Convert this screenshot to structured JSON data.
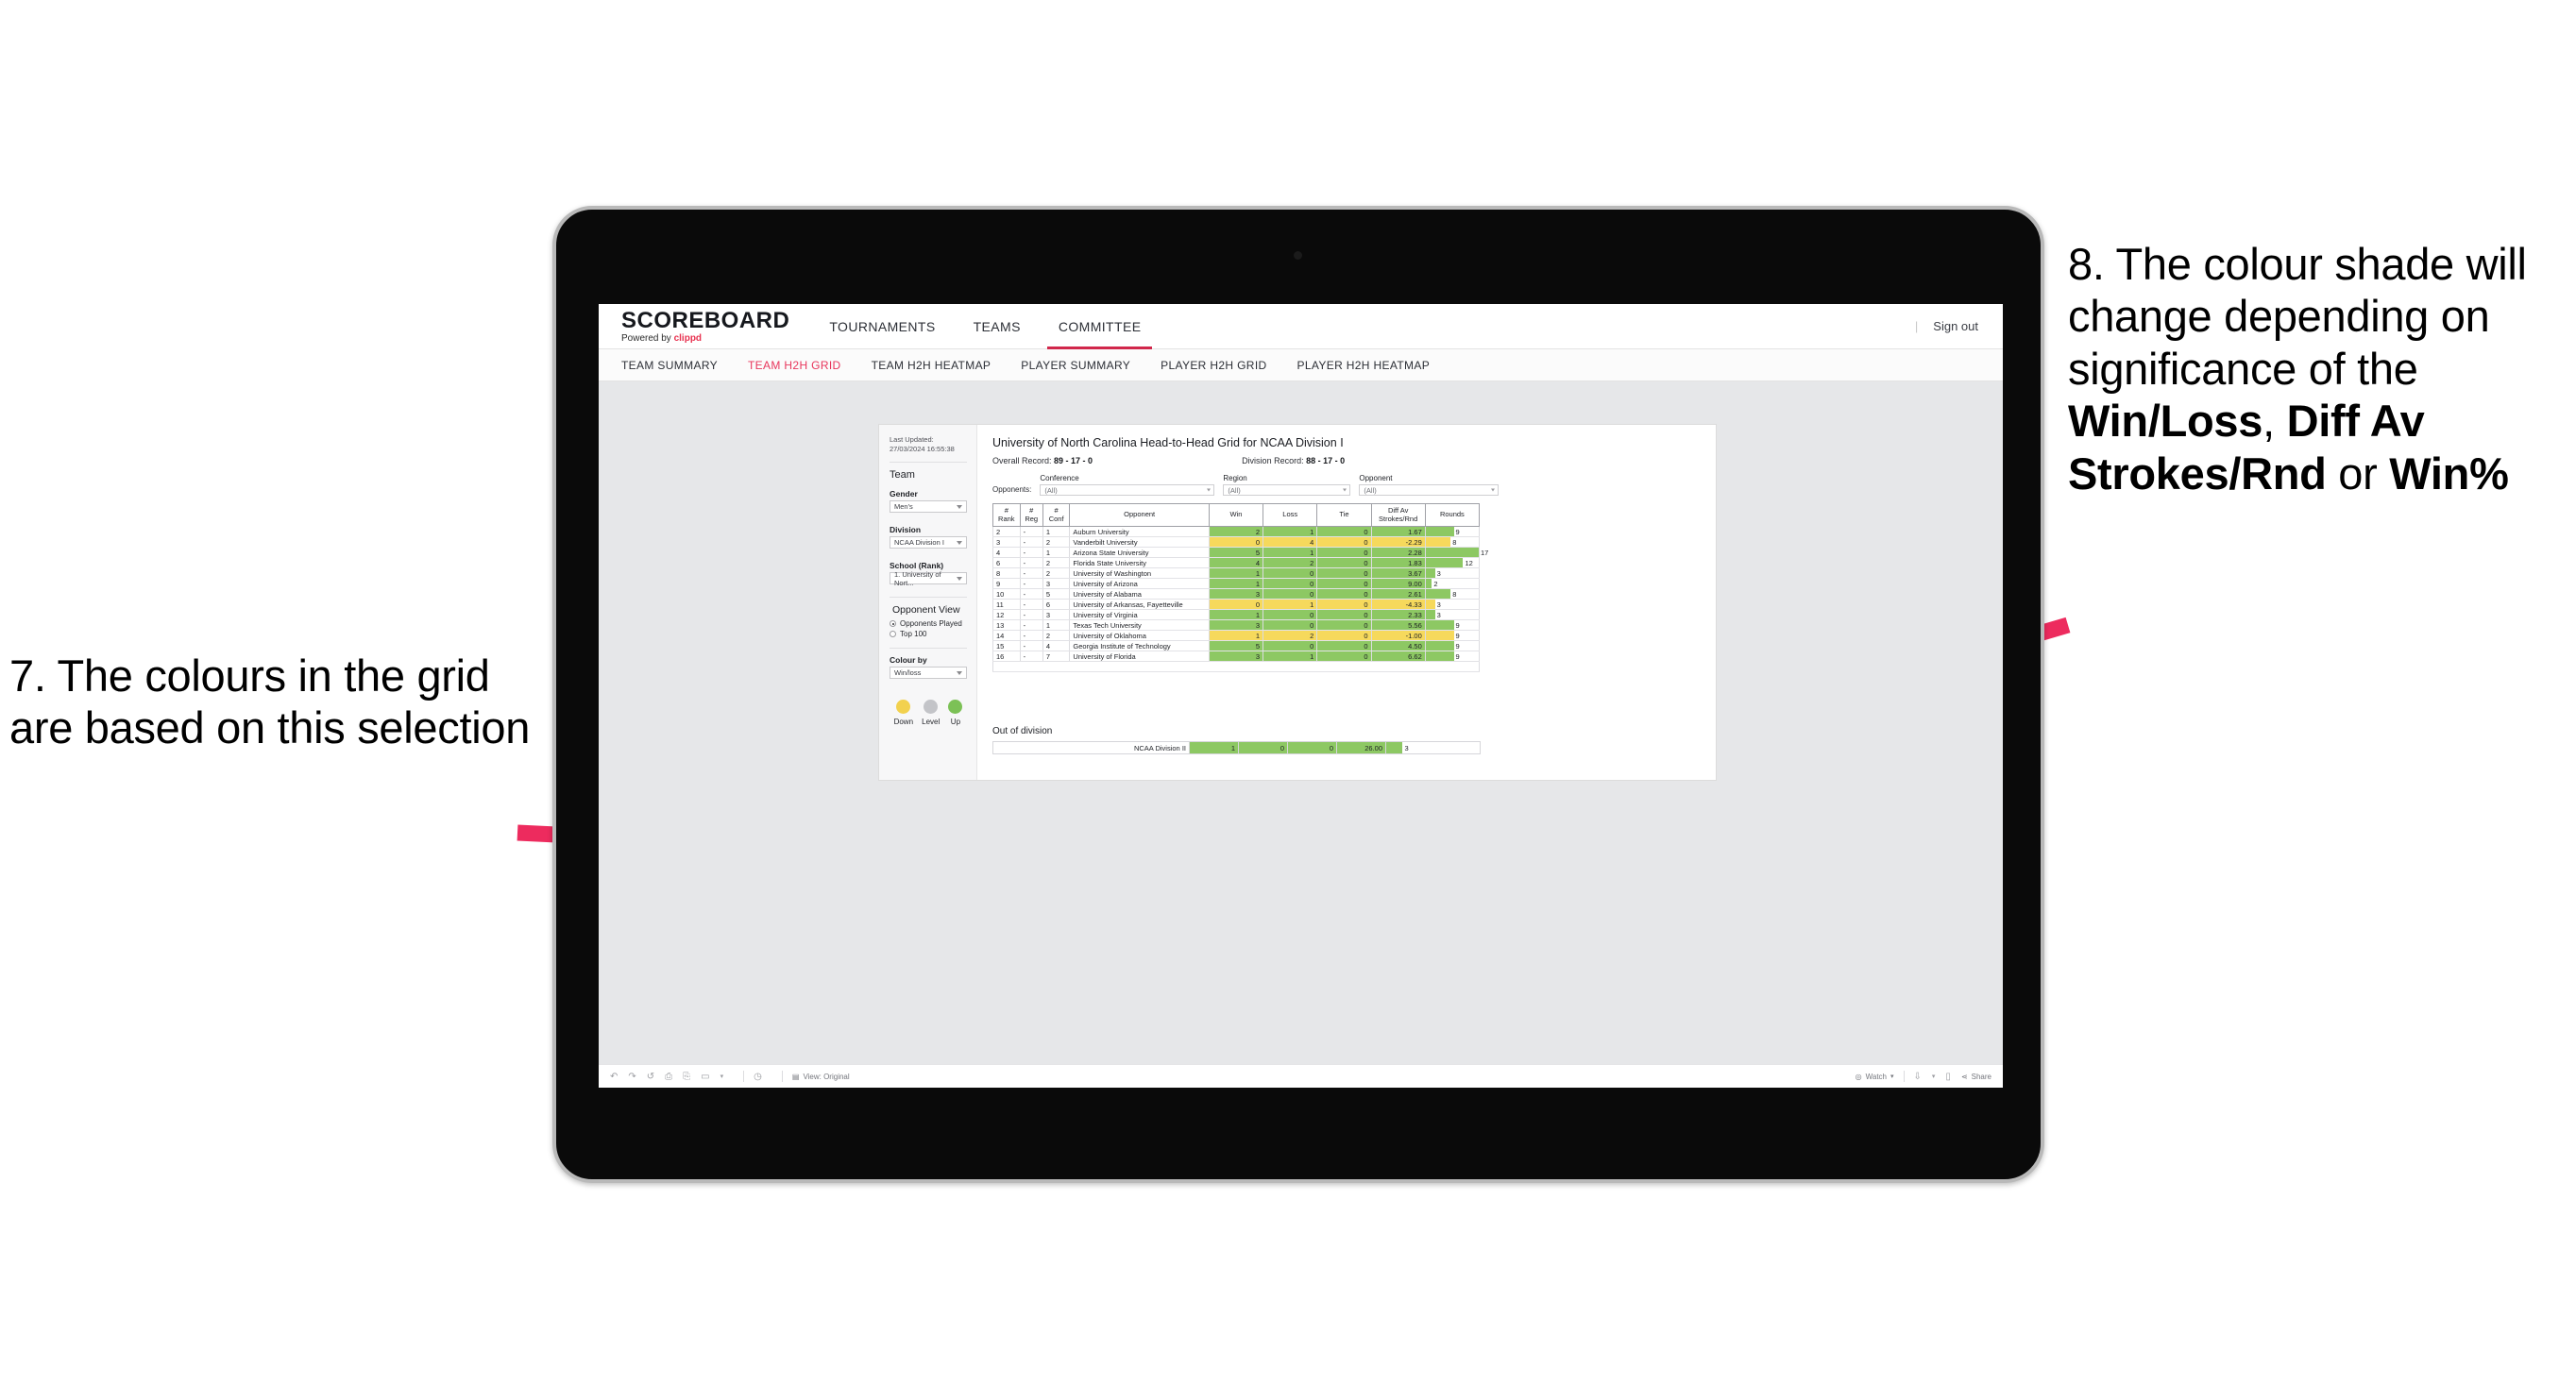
{
  "annotations": {
    "left": "7. The colours in the grid are based on this selection",
    "right_pre": "8. The colour shade will change depending on significance of the ",
    "right_b1": "Win/Loss",
    "right_mid1": ", ",
    "right_b2": "Diff Av Strokes/Rnd",
    "right_mid2": " or ",
    "right_b3": "Win%",
    "arrow_color": "#ed2b5e"
  },
  "app": {
    "brand_title": "SCOREBOARD",
    "brand_sub_pre": "Powered by ",
    "brand_sub_name": "clippd",
    "topnav": [
      {
        "label": "TOURNAMENTS",
        "active": false
      },
      {
        "label": "TEAMS",
        "active": false
      },
      {
        "label": "COMMITTEE",
        "active": true
      }
    ],
    "signout_divider": "|",
    "signout": "Sign out",
    "subnav": [
      {
        "label": "TEAM SUMMARY",
        "active": false
      },
      {
        "label": "TEAM H2H GRID",
        "active": true
      },
      {
        "label": "TEAM H2H HEATMAP",
        "active": false
      },
      {
        "label": "PLAYER SUMMARY",
        "active": false
      },
      {
        "label": "PLAYER H2H GRID",
        "active": false
      },
      {
        "label": "PLAYER H2H HEATMAP",
        "active": false
      }
    ]
  },
  "sidebar": {
    "last_updated": "Last Updated: 27/03/2024 16:55:38",
    "team_heading": "Team",
    "fields": [
      {
        "label": "Gender",
        "value": "Men's"
      },
      {
        "label": "Division",
        "value": "NCAA Division I"
      },
      {
        "label": "School (Rank)",
        "value": "1. University of Nort..."
      }
    ],
    "opponent_view_heading": "Opponent View",
    "opponent_view_options": [
      {
        "label": "Opponents Played",
        "selected": true
      },
      {
        "label": "Top 100",
        "selected": false
      }
    ],
    "colour_by_label": "Colour by",
    "colour_by_value": "Win/loss",
    "legend": [
      {
        "label": "Down",
        "color": "#f2d14e"
      },
      {
        "label": "Level",
        "color": "#c3c4c8"
      },
      {
        "label": "Up",
        "color": "#7cc156"
      }
    ]
  },
  "main": {
    "title": "University of North Carolina Head-to-Head Grid for NCAA Division I",
    "overall_record_label": "Overall Record: ",
    "overall_record_value": "89 - 17 - 0",
    "division_record_label": "Division Record: ",
    "division_record_value": "88 - 17 - 0",
    "opponents_label": "Opponents:",
    "opponent_filters": [
      {
        "label": "Conference",
        "value": "(All)"
      },
      {
        "label": "Region",
        "value": "(All)"
      },
      {
        "label": "Opponent",
        "value": "(All)"
      }
    ],
    "out_of_division_heading": "Out of division"
  },
  "toolbar": {
    "view_label": "View: Original",
    "watch_label": "Watch",
    "share_label": "Share"
  },
  "chart_data": {
    "type": "table",
    "title": "University of North Carolina Head-to-Head Grid for NCAA Division I",
    "columns": [
      {
        "key": "rank",
        "header_l1": "#",
        "header_l2": "Rank"
      },
      {
        "key": "reg",
        "header_l1": "#",
        "header_l2": "Reg"
      },
      {
        "key": "conf",
        "header_l1": "#",
        "header_l2": "Conf"
      },
      {
        "key": "opponent",
        "header_l1": "",
        "header_l2": "Opponent"
      },
      {
        "key": "win",
        "header_l1": "",
        "header_l2": "Win"
      },
      {
        "key": "loss",
        "header_l1": "",
        "header_l2": "Loss"
      },
      {
        "key": "tie",
        "header_l1": "",
        "header_l2": "Tie"
      },
      {
        "key": "diff",
        "header_l1": "Diff Av",
        "header_l2": "Strokes/Rnd"
      },
      {
        "key": "rounds",
        "header_l1": "",
        "header_l2": "Rounds"
      }
    ],
    "colour_scale": {
      "up": "#8dc863",
      "down": "#f6d95c",
      "level": "#c3c4c8"
    },
    "rounds_max": 17,
    "rows": [
      {
        "rank": "2",
        "reg": "-",
        "conf": "1",
        "opponent": "Auburn University",
        "win": "2",
        "loss": "1",
        "tie": "0",
        "diff": "1.67",
        "rounds": 9,
        "shade": "up"
      },
      {
        "rank": "3",
        "reg": "-",
        "conf": "2",
        "opponent": "Vanderbilt University",
        "win": "0",
        "loss": "4",
        "tie": "0",
        "diff": "-2.29",
        "rounds": 8,
        "shade": "down"
      },
      {
        "rank": "4",
        "reg": "-",
        "conf": "1",
        "opponent": "Arizona State University",
        "win": "5",
        "loss": "1",
        "tie": "0",
        "diff": "2.28",
        "rounds": 17,
        "shade": "up"
      },
      {
        "rank": "6",
        "reg": "-",
        "conf": "2",
        "opponent": "Florida State University",
        "win": "4",
        "loss": "2",
        "tie": "0",
        "diff": "1.83",
        "rounds": 12,
        "shade": "up"
      },
      {
        "rank": "8",
        "reg": "-",
        "conf": "2",
        "opponent": "University of Washington",
        "win": "1",
        "loss": "0",
        "tie": "0",
        "diff": "3.67",
        "rounds": 3,
        "shade": "up"
      },
      {
        "rank": "9",
        "reg": "-",
        "conf": "3",
        "opponent": "University of Arizona",
        "win": "1",
        "loss": "0",
        "tie": "0",
        "diff": "9.00",
        "rounds": 2,
        "shade": "up"
      },
      {
        "rank": "10",
        "reg": "-",
        "conf": "5",
        "opponent": "University of Alabama",
        "win": "3",
        "loss": "0",
        "tie": "0",
        "diff": "2.61",
        "rounds": 8,
        "shade": "up"
      },
      {
        "rank": "11",
        "reg": "-",
        "conf": "6",
        "opponent": "University of Arkansas, Fayetteville",
        "win": "0",
        "loss": "1",
        "tie": "0",
        "diff": "-4.33",
        "rounds": 3,
        "shade": "down"
      },
      {
        "rank": "12",
        "reg": "-",
        "conf": "3",
        "opponent": "University of Virginia",
        "win": "1",
        "loss": "0",
        "tie": "0",
        "diff": "2.33",
        "rounds": 3,
        "shade": "up"
      },
      {
        "rank": "13",
        "reg": "-",
        "conf": "1",
        "opponent": "Texas Tech University",
        "win": "3",
        "loss": "0",
        "tie": "0",
        "diff": "5.56",
        "rounds": 9,
        "shade": "up"
      },
      {
        "rank": "14",
        "reg": "-",
        "conf": "2",
        "opponent": "University of Oklahoma",
        "win": "1",
        "loss": "2",
        "tie": "0",
        "diff": "-1.00",
        "rounds": 9,
        "shade": "down"
      },
      {
        "rank": "15",
        "reg": "-",
        "conf": "4",
        "opponent": "Georgia Institute of Technology",
        "win": "5",
        "loss": "0",
        "tie": "0",
        "diff": "4.50",
        "rounds": 9,
        "shade": "up"
      },
      {
        "rank": "16",
        "reg": "-",
        "conf": "7",
        "opponent": "University of Florida",
        "win": "3",
        "loss": "1",
        "tie": "0",
        "diff": "6.62",
        "rounds": 9,
        "shade": "up"
      }
    ],
    "out_of_division": [
      {
        "opponent": "NCAA Division II",
        "win": "1",
        "loss": "0",
        "tie": "0",
        "diff": "26.00",
        "rounds": 3,
        "shade": "up"
      }
    ]
  }
}
